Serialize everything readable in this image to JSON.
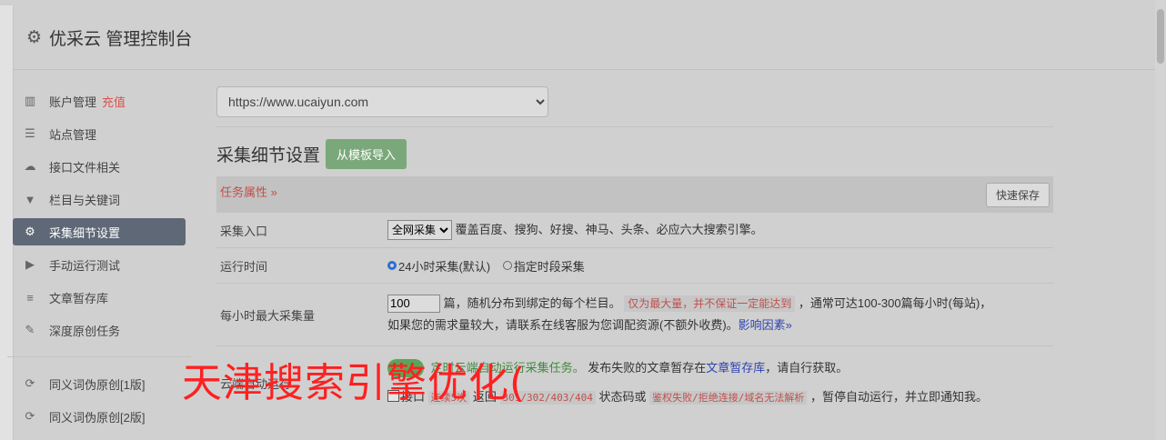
{
  "header": {
    "title": "优采云 管理控制台",
    "icon": "gear-icon"
  },
  "sidebar": {
    "items": [
      {
        "label": "账户管理",
        "tag": "充值",
        "icon": "bar-chart-icon"
      },
      {
        "label": "站点管理",
        "icon": "server-icon"
      },
      {
        "label": "接口文件相关",
        "icon": "cloud-upload-icon"
      },
      {
        "label": "栏目与关键词",
        "icon": "filter-icon"
      },
      {
        "label": "采集细节设置",
        "icon": "gears-icon",
        "active": true
      },
      {
        "label": "手动运行测试",
        "icon": "play-icon"
      },
      {
        "label": "文章暂存库",
        "icon": "database-icon"
      },
      {
        "label": "深度原创任务",
        "icon": "edit-icon"
      }
    ],
    "items2": [
      {
        "label": "同义词伪原创[1版]",
        "icon": "refresh-icon"
      },
      {
        "label": "同义词伪原创[2版]",
        "icon": "refresh-icon"
      }
    ]
  },
  "main": {
    "site_select": "https://www.ucaiyun.com",
    "section_title": "采集细节设置",
    "import_button": "从模板导入",
    "task_attr": "任务属性 »",
    "save_button": "快速保存",
    "rows": {
      "entry": {
        "label": "采集入口",
        "select": "全网采集",
        "desc": "覆盖百度、搜狗、好搜、神马、头条、必应六大搜索引擎。"
      },
      "time": {
        "label": "运行时间",
        "opt1": "24小时采集(默认)",
        "opt2": "指定时段采集"
      },
      "max": {
        "label": "每小时最大采集量",
        "value": "100",
        "text1": "篇，随机分布到绑定的每个栏目。",
        "warn": "仅为最大量，并不保证一定能达到",
        "text2": "，通常可达100-300篇每小时(每站)，",
        "text3": "如果您的需求量较大，请联系在线客服为您调配资源(不额外收费)。",
        "link": "影响因素»"
      },
      "cloud": {
        "label": "云端自动运行",
        "text1": "定时云端自动运行采集任务。",
        "text2": "发布失败的文章暂存在",
        "link": "文章暂存库",
        "text3": "，请自行获取。",
        "cb_label": "接口",
        "code1": "连续5次",
        "text4": "返回",
        "code2": "301/302/403/404",
        "text5": "状态码或",
        "code3": "鉴权失败/拒绝连接/域名无法解析",
        "text6": "，暂停自动运行，并立即通知我。"
      }
    }
  },
  "watermark": "天津搜索引擎优化("
}
